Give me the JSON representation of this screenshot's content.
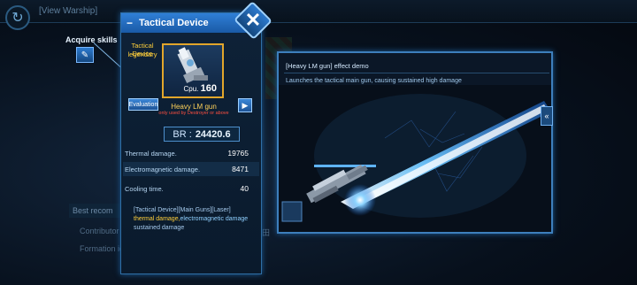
{
  "background": {
    "title": "[View Warship]",
    "best_recommend": "Best recom",
    "contributor": "Contributor",
    "formation": "Formation ide",
    "extra_char": "田"
  },
  "acquire": {
    "label": "Acquire skills"
  },
  "panel": {
    "title": "Tactical Device",
    "type": "Tactical Device",
    "rarity": "legendary",
    "cpu_label": "Cpu.",
    "cpu_value": "160",
    "evaluation": "Evaluation",
    "item_name": "Heavy LM gun",
    "note": "only used by Destroyer or above",
    "br_label": "BR :",
    "br_value": "24420.6",
    "stats": [
      {
        "name": "Thermal damage.",
        "value": "19765"
      },
      {
        "name": "Electromagnetic damage.",
        "value": "8471"
      },
      {
        "name": "Cooling time.",
        "value": "40"
      }
    ],
    "desc_tags": "[Tactical Device][Main Guns][Laser]",
    "desc_damage_a": "thermal damage,",
    "desc_damage_b": "electromagnetic damage",
    "desc_tail": "sustained damage"
  },
  "demo": {
    "title": "[Heavy LM gun] effect demo",
    "description": "Launches the tactical main gun, causing sustained high damage"
  },
  "colors": {
    "accent": "#2f7fd6",
    "legendary": "#ffcf3a",
    "warning": "#ff5040",
    "beam": "#6fc7ff"
  }
}
